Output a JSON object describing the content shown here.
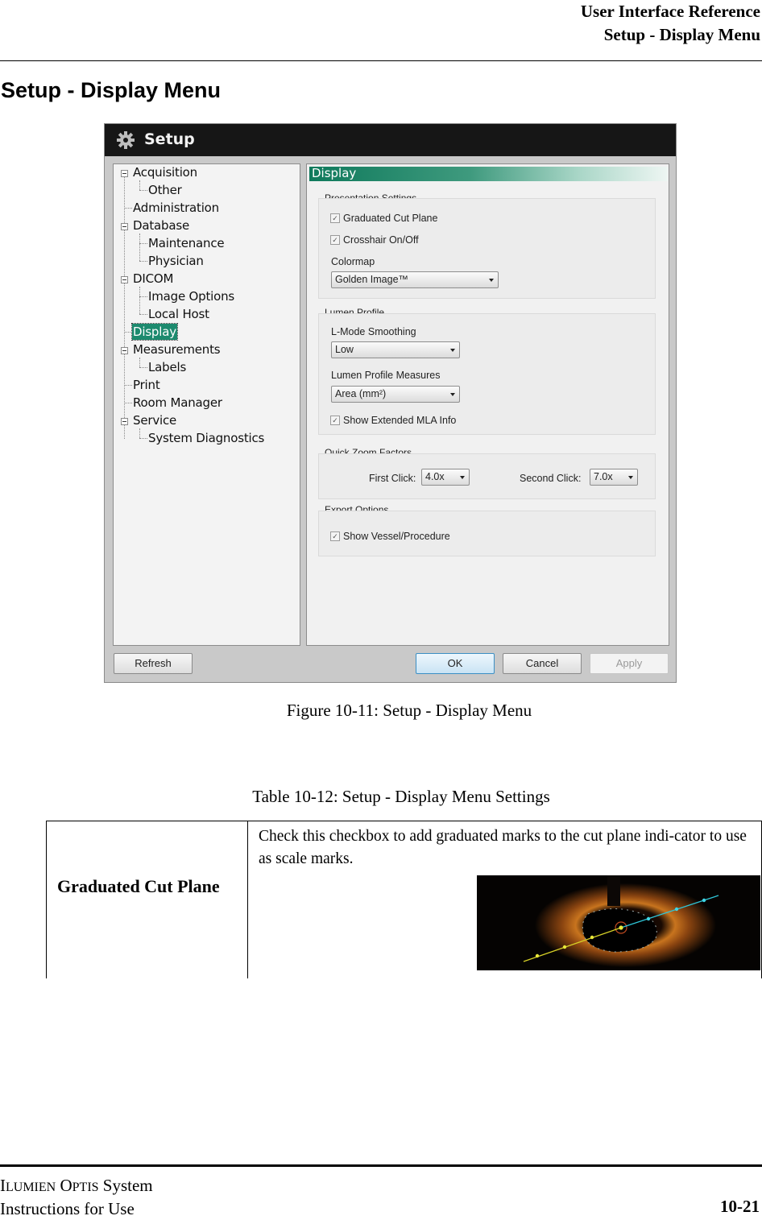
{
  "running_head": {
    "line1": "User Interface Reference",
    "line2": "Setup - Display Menu"
  },
  "section_title": "Setup - Display Menu",
  "dialog": {
    "title": "Setup",
    "title_icon": "gear-icon",
    "tree": [
      {
        "label": "Acquisition",
        "level": 0,
        "expandable": true
      },
      {
        "label": "Other",
        "level": 1
      },
      {
        "label": "Administration",
        "level": 0
      },
      {
        "label": "Database",
        "level": 0,
        "expandable": true
      },
      {
        "label": "Maintenance",
        "level": 1
      },
      {
        "label": "Physician",
        "level": 1
      },
      {
        "label": "DICOM",
        "level": 0,
        "expandable": true
      },
      {
        "label": "Image Options",
        "level": 1
      },
      {
        "label": "Local Host",
        "level": 1
      },
      {
        "label": "Display",
        "level": 0,
        "selected": true
      },
      {
        "label": "Measurements",
        "level": 0,
        "expandable": true
      },
      {
        "label": "Labels",
        "level": 1
      },
      {
        "label": "Print",
        "level": 0
      },
      {
        "label": "Room Manager",
        "level": 0
      },
      {
        "label": "Service",
        "level": 0,
        "expandable": true
      },
      {
        "label": "System Diagnostics",
        "level": 1
      }
    ],
    "panel_title": "Display",
    "presentation": {
      "label": "Presentation Settings",
      "graduated_cut_plane": {
        "label": "Graduated Cut Plane",
        "checked": true
      },
      "crosshair": {
        "label": "Crosshair On/Off",
        "checked": true
      },
      "colormap_label": "Colormap",
      "colormap_value": "Golden Image™"
    },
    "lumen_profile": {
      "label": "Lumen Profile",
      "smoothing_label": "L-Mode Smoothing",
      "smoothing_value": "Low",
      "measures_label": "Lumen Profile Measures",
      "measures_value": "Area (mm²)",
      "extended_mla": {
        "label": "Show Extended MLA Info",
        "checked": true
      }
    },
    "quick_zoom": {
      "label": "Quick Zoom Factors",
      "first_label": "First Click:",
      "first_value": "4.0x",
      "second_label": "Second Click:",
      "second_value": "7.0x"
    },
    "export": {
      "label": "Export Options",
      "show_vessel": {
        "label": "Show Vessel/Procedure",
        "checked": true
      }
    },
    "buttons": {
      "refresh": "Refresh",
      "ok": "OK",
      "cancel": "Cancel",
      "apply": "Apply"
    },
    "check_glyph": "✓"
  },
  "figure_caption": "Figure 10-11:  Setup - Display Menu",
  "table_caption": "Table 10-12:  Setup - Display Menu Settings",
  "table": {
    "rows": [
      {
        "term": "Graduated Cut Plane",
        "description": "Check this checkbox to add graduated marks to the cut plane indi-cator to use as scale marks.",
        "image": "oct-cross-section-with-graduated-cut-plane"
      }
    ]
  },
  "footer": {
    "product_i": "I",
    "product_lumien": "LUMIEN",
    "product_o": "O",
    "product_ptis": "PTIS",
    "product_system": " System",
    "line2": "Instructions for Use",
    "page": "10-21"
  }
}
